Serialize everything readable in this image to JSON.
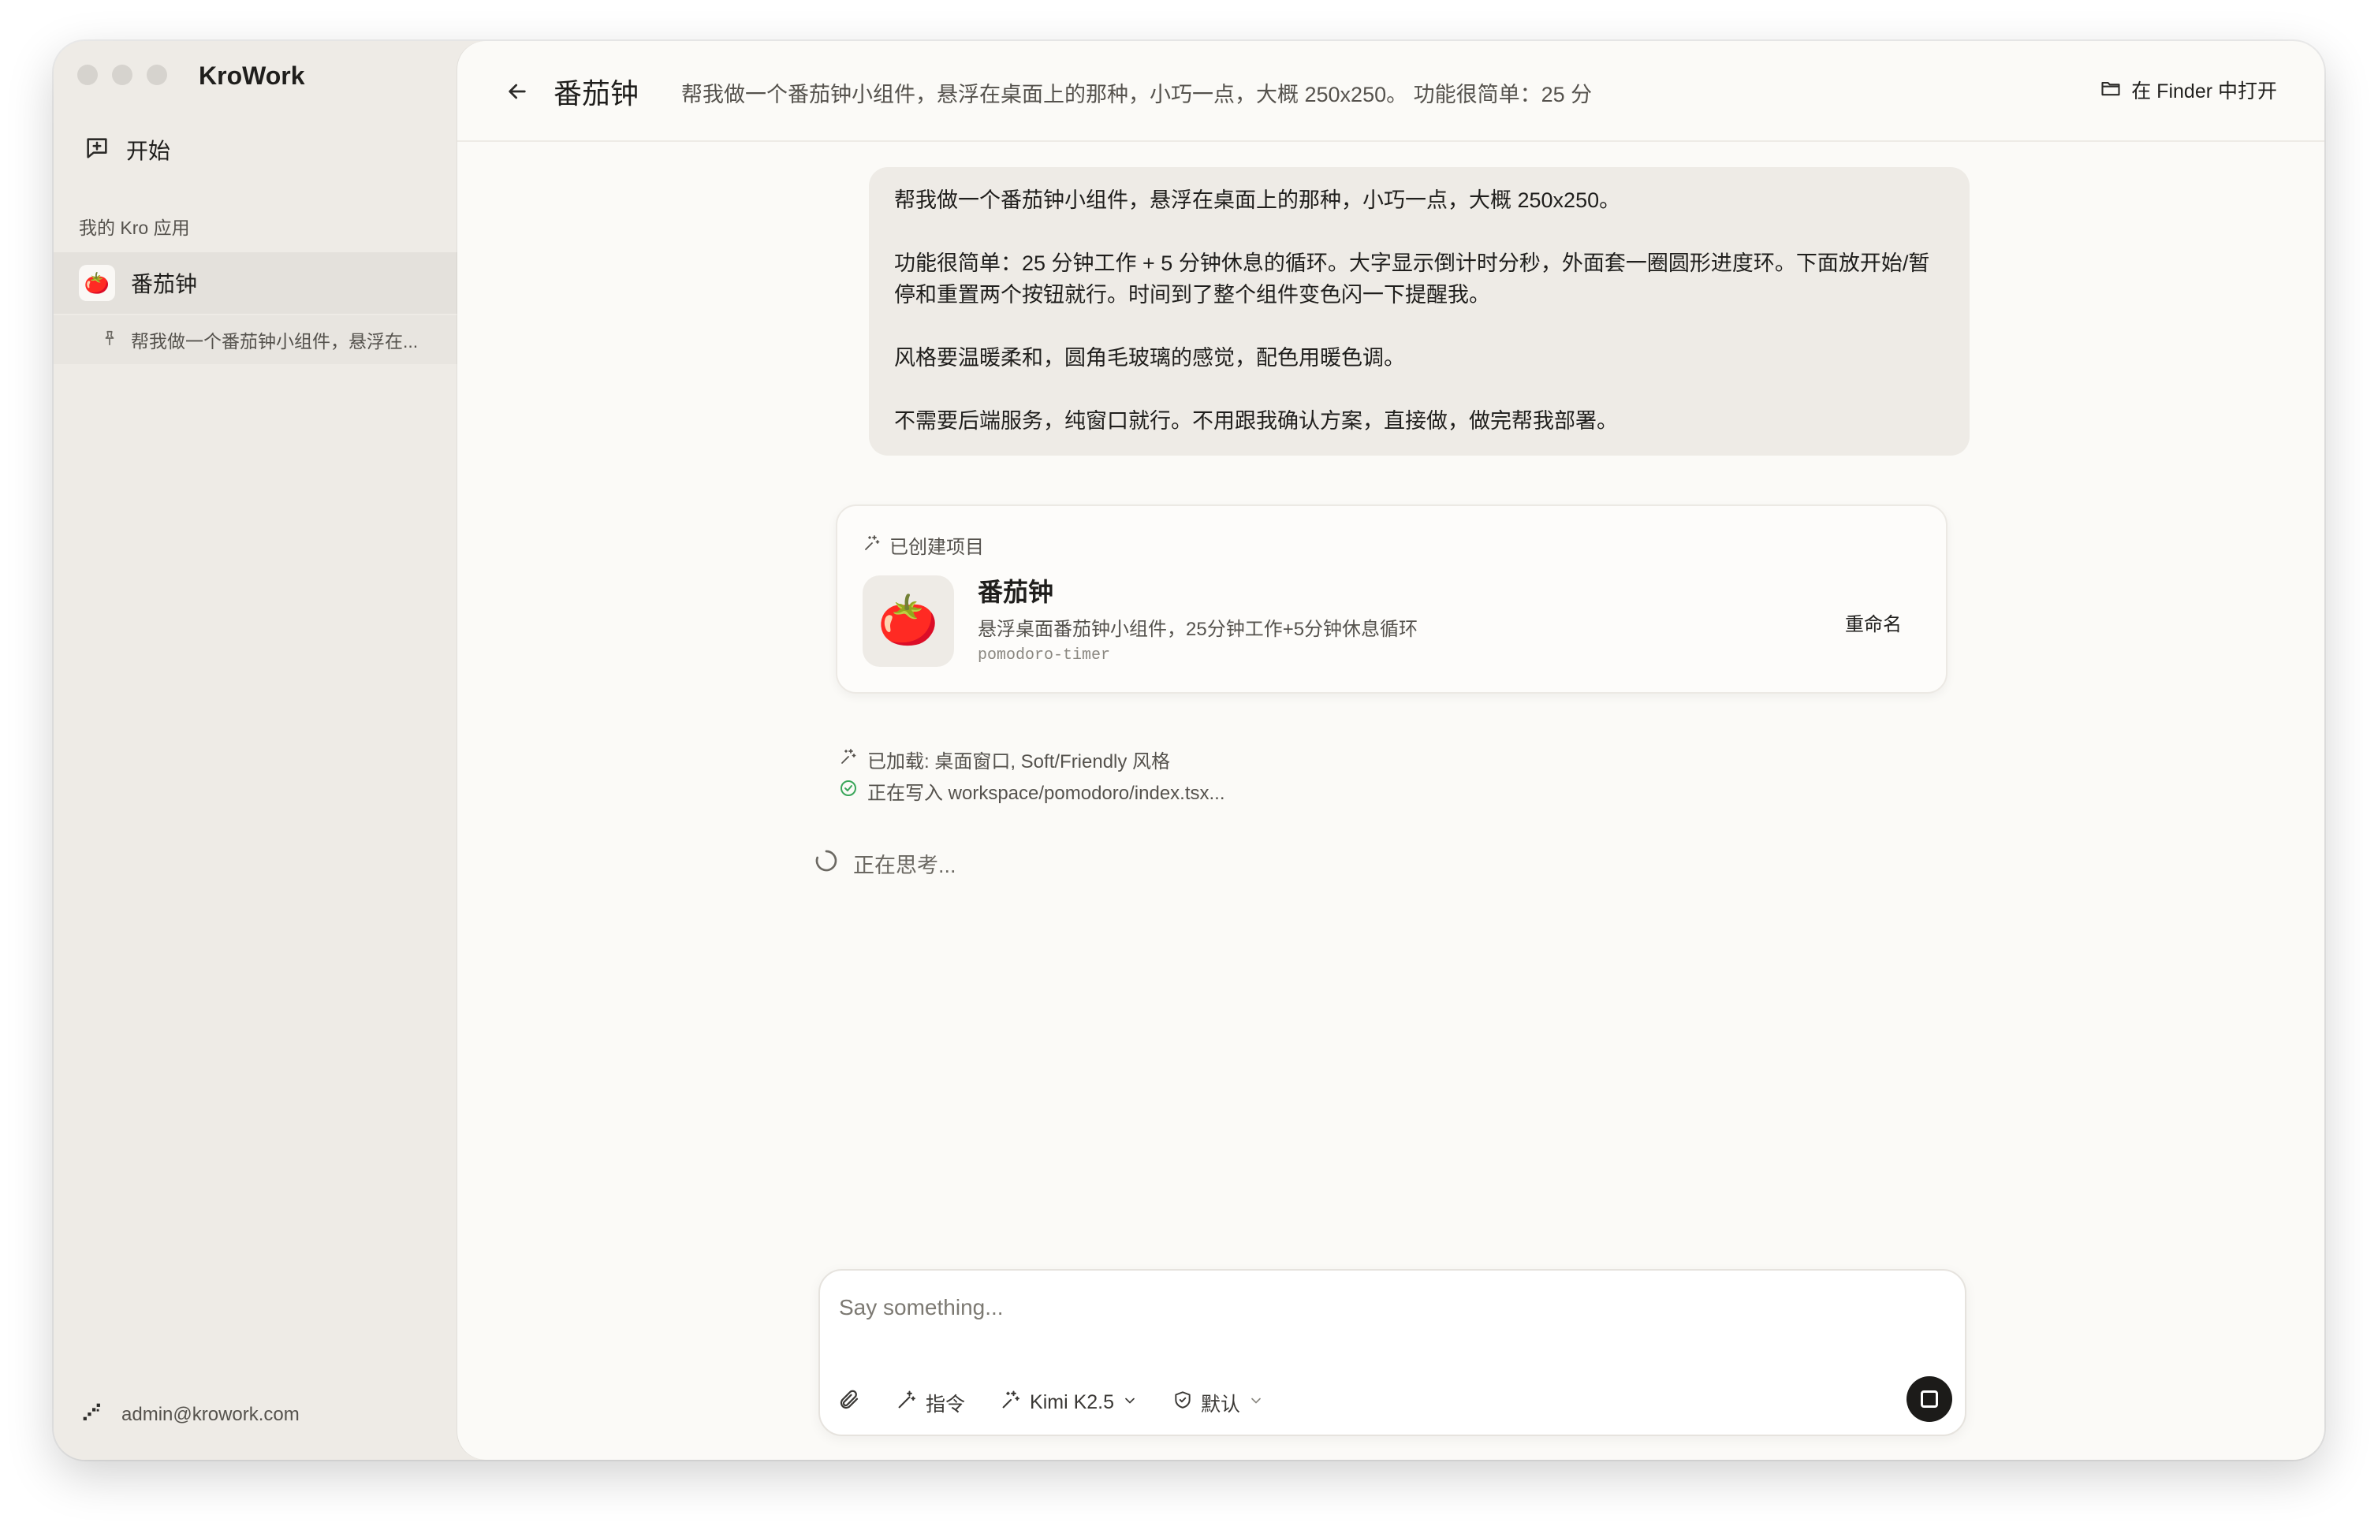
{
  "app": {
    "title": "KroWork"
  },
  "sidebar": {
    "start_label": "开始",
    "section_label": "我的 Kro 应用",
    "apps": [
      {
        "name": "番茄钟",
        "icon": "tomato-icon",
        "emoji": "🍅"
      }
    ],
    "sessions": [
      {
        "label": "帮我做一个番茄钟小组件，悬浮在..."
      }
    ],
    "user_email": "admin@krowork.com"
  },
  "header": {
    "title": "番茄钟",
    "subtitle": "帮我做一个番茄钟小组件，悬浮在桌面上的那种，小巧一点，大概 250x250。 功能很简单：25 分",
    "finder_label": "在 Finder 中打开"
  },
  "message": {
    "paragraphs": [
      "帮我做一个番茄钟小组件，悬浮在桌面上的那种，小巧一点，大概 250x250。",
      "功能很简单：25 分钟工作 + 5 分钟休息的循环。大字显示倒计时分秒，外面套一圈圆形进度环。下面放开始/暂停和重置两个按钮就行。时间到了整个组件变色闪一下提醒我。",
      "风格要温暖柔和，圆角毛玻璃的感觉，配色用暖色调。",
      "不需要后端服务，纯窗口就行。不用跟我确认方案，直接做，做完帮我部署。"
    ]
  },
  "project_card": {
    "header": "已创建项目",
    "name": "番茄钟",
    "description": "悬浮桌面番茄钟小组件，25分钟工作+5分钟休息循环",
    "slug": "pomodoro-timer",
    "rename_label": "重命名",
    "emoji": "🍅"
  },
  "steps": [
    {
      "icon": "sparkle-icon",
      "text": "已加载: 桌面窗口, Soft/Friendly 风格"
    },
    {
      "icon": "check-circle-icon",
      "text": "正在写入 workspace/pomodoro/index.tsx..."
    }
  ],
  "thinking_label": "正在思考...",
  "composer": {
    "placeholder": "Say something...",
    "command_label": "指令",
    "model_label": "Kimi K2.5",
    "mode_label": "默认"
  },
  "colors": {
    "sidebar_bg": "#eeebe6",
    "main_bg": "#fbfaf7",
    "success": "#3aa65a",
    "send_button": "#1c1b19"
  }
}
